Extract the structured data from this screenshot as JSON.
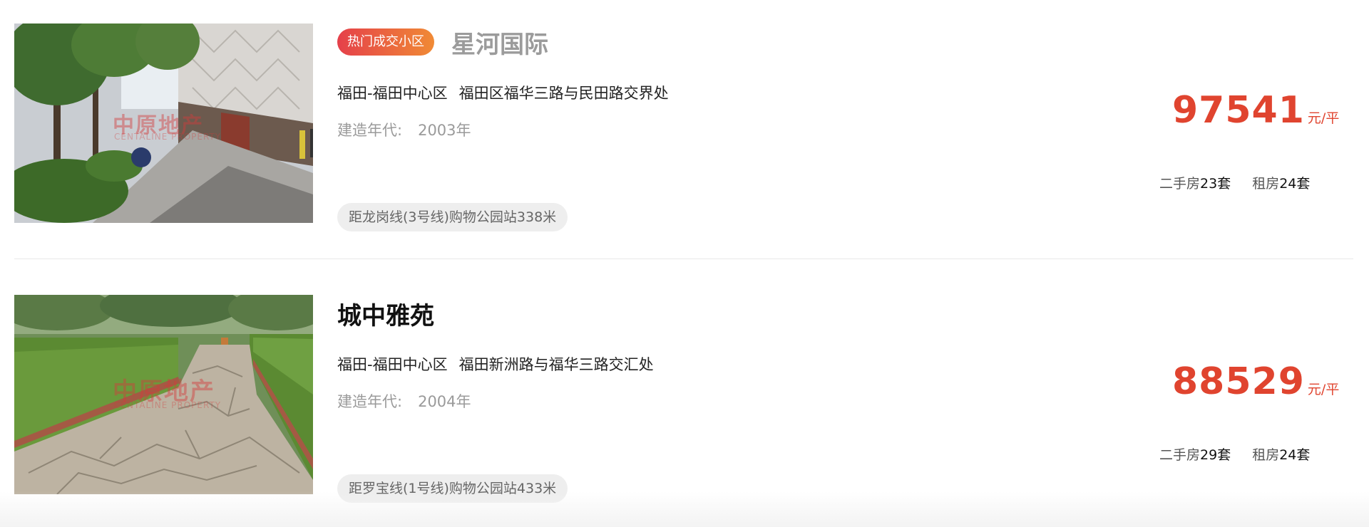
{
  "listings": [
    {
      "badge": "热门成交小区",
      "name": "星河国际",
      "district": "福田-福田中心区",
      "street": "福田区福华三路与民田路交界处",
      "year_label": "建造年代:",
      "year": "2003年",
      "subway": "距龙岗线(3号线)购物公园站338米",
      "price": "97541",
      "price_unit": "元/平",
      "secondhand_label": "二手房",
      "secondhand_count": "23套",
      "rent_label": "租房",
      "rent_count": "24套",
      "watermark": "中原地产",
      "watermark_sub": "CENTALINE PROPERTY"
    },
    {
      "name": "城中雅苑",
      "district": "福田-福田中心区",
      "street": "福田新洲路与福华三路交汇处",
      "year_label": "建造年代:",
      "year": "2004年",
      "subway": "距罗宝线(1号线)购物公园站433米",
      "price": "88529",
      "price_unit": "元/平",
      "secondhand_label": "二手房",
      "secondhand_count": "29套",
      "rent_label": "租房",
      "rent_count": "24套",
      "watermark": "中原地产",
      "watermark_sub": "CENTALINE PROPERTY"
    }
  ],
  "colors": {
    "price": "#e0442f",
    "badge_start": "#e5404a",
    "badge_end": "#f08a35",
    "muted_text": "#9a9a9a"
  }
}
